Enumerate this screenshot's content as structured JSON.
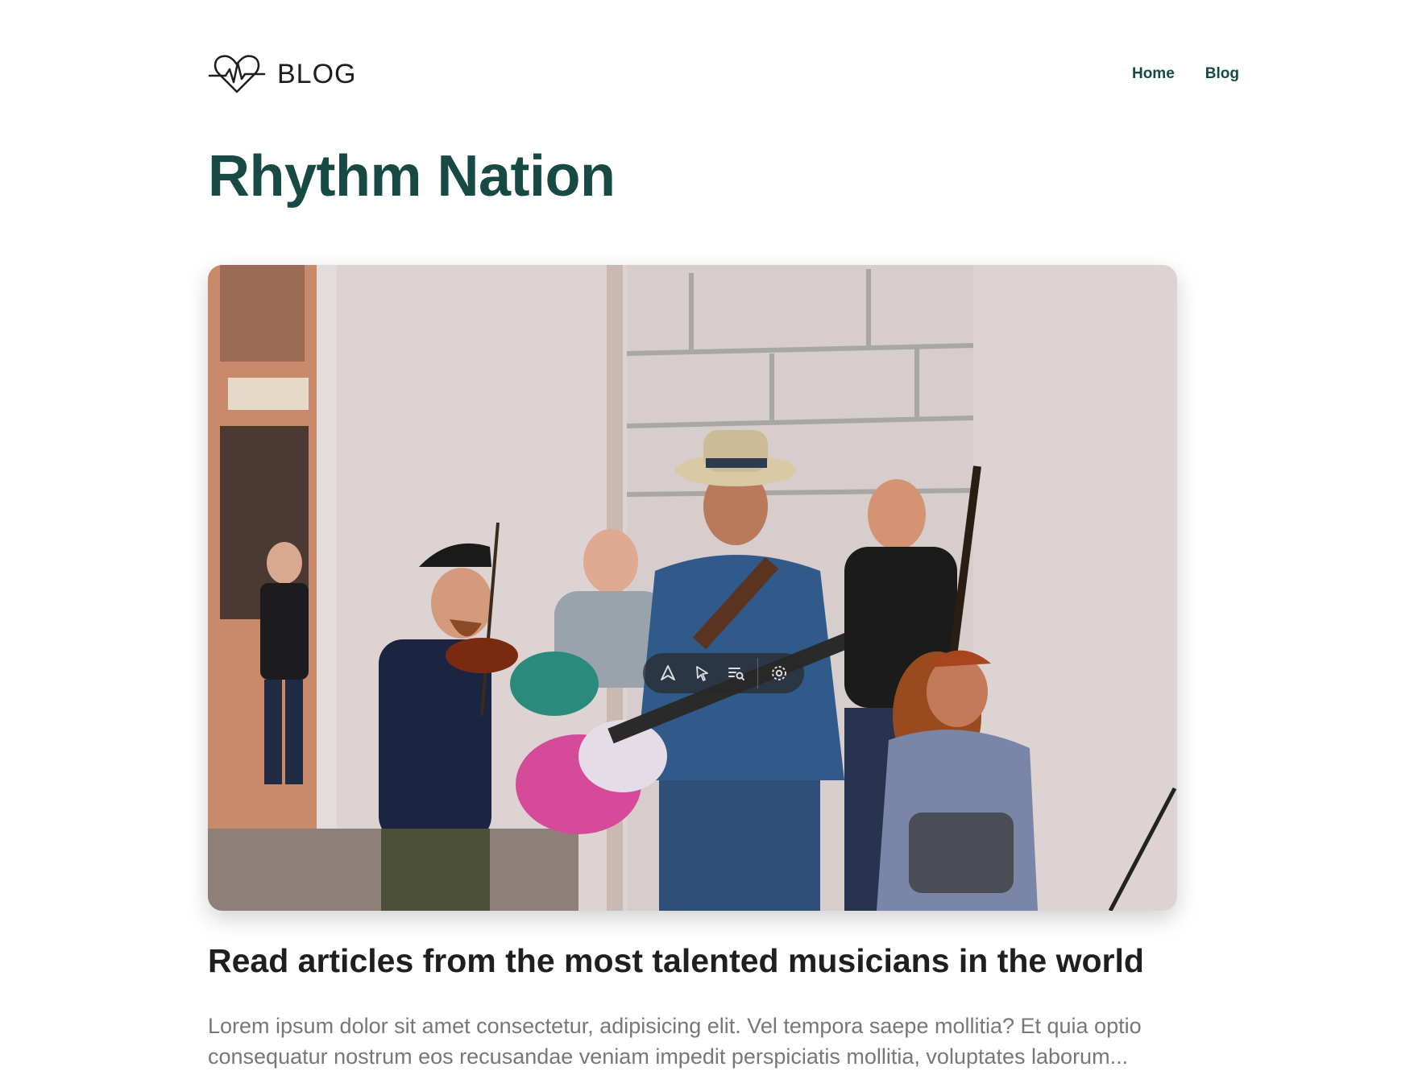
{
  "header": {
    "logo_text": "BLOG",
    "logo_icon": "heartbeat-icon",
    "nav": [
      {
        "label": "Home"
      },
      {
        "label": "Blog"
      }
    ]
  },
  "page": {
    "title": "Rhythm Nation"
  },
  "hero_image": {
    "subject": "street musicians playing guitar, violin and double bass",
    "toolbar_icons": [
      "ai-assistant-icon",
      "cursor-select-icon",
      "text-search-icon",
      "settings-icon"
    ]
  },
  "article": {
    "headline": "Read articles from the most talented musicians in the world",
    "excerpt": "Lorem ipsum dolor sit amet consectetur, adipisicing elit. Vel tempora saepe mollitia? Et quia optio consequatur nostrum eos recusandae veniam impedit perspiciatis mollitia, voluptates laborum..."
  },
  "colors": {
    "brand": "#184a45",
    "headline": "#1f1f1f",
    "excerpt": "#777777"
  }
}
